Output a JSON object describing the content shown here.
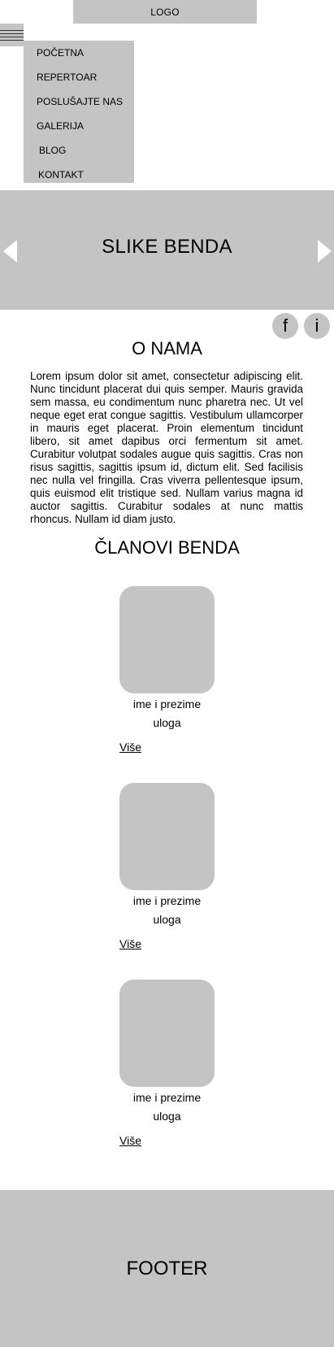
{
  "header": {
    "logo": "LOGO"
  },
  "nav": {
    "items": [
      {
        "label": "POČETNA"
      },
      {
        "label": "REPERTOAR"
      },
      {
        "label": "POSLUŠAJTE NAS"
      },
      {
        "label": "GALERIJA"
      },
      {
        "label": "BLOG"
      },
      {
        "label": "KONTAKT"
      }
    ]
  },
  "hero": {
    "title": "SLIKE BENDA",
    "prev_icon": "chevron-left-icon",
    "next_icon": "chevron-right-icon"
  },
  "social": {
    "facebook": "f",
    "instagram": "i"
  },
  "about": {
    "title": "O NAMA",
    "text": "Lorem ipsum dolor sit amet, consectetur adipiscing elit. Nunc tincidunt placerat dui quis semper. Mauris gravida sem massa, eu condimentum nunc pharetra nec. Ut vel neque eget erat congue sagittis. Vestibulum ullamcorper in mauris eget placerat. Proin elementum tincidunt libero, sit amet dapibus orci fermentum sit amet. Curabitur volutpat sodales augue quis sagittis. Cras non risus sagittis, sagittis ipsum id, dictum elit. Sed facilisis nec nulla vel fringilla. Cras viverra pellentesque ipsum, quis euismod elit tristique sed. Nullam varius magna id auctor sagittis. Curabitur sodales at nunc mattis rhoncus. Nullam id diam justo."
  },
  "members": {
    "title": "ČLANOVI BENDA",
    "items": [
      {
        "name": "ime i prezime",
        "role": "uloga",
        "more": "Više"
      },
      {
        "name": "ime i prezime",
        "role": "uloga",
        "more": "Više"
      },
      {
        "name": "ime i prezime",
        "role": "uloga",
        "more": "Više"
      }
    ]
  },
  "footer": {
    "label": "FOOTER"
  },
  "colors": {
    "placeholder_gray": "#c4c4c4",
    "background": "#ffffff",
    "text": "#000000"
  }
}
